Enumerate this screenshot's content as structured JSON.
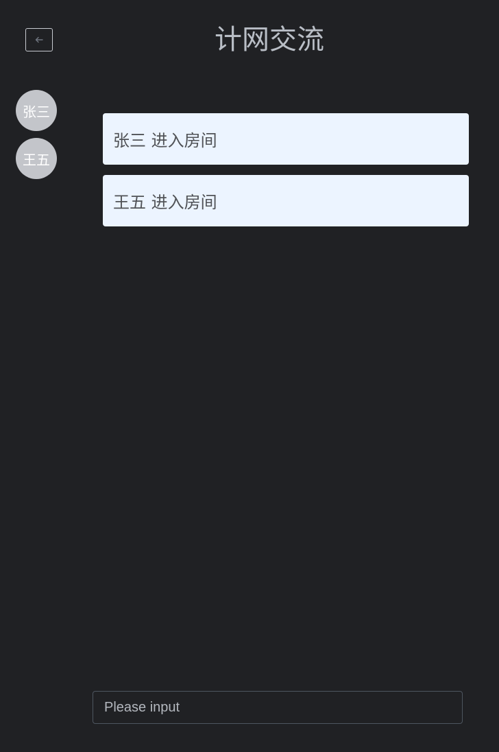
{
  "header": {
    "title": "计网交流",
    "back_icon": "arrow-left-icon"
  },
  "users": [
    {
      "name": "张三"
    },
    {
      "name": "王五"
    }
  ],
  "messages": [
    {
      "text": "张三 进入房间"
    },
    {
      "text": "王五 进入房间"
    }
  ],
  "composer": {
    "placeholder": "Please input",
    "value": ""
  },
  "colors": {
    "background": "#202124",
    "title": "#b9bec6",
    "avatar": "#c3c5ca",
    "message_bg": "#ecf4ff",
    "message_text": "#505256",
    "input_border": "#4e5660"
  }
}
